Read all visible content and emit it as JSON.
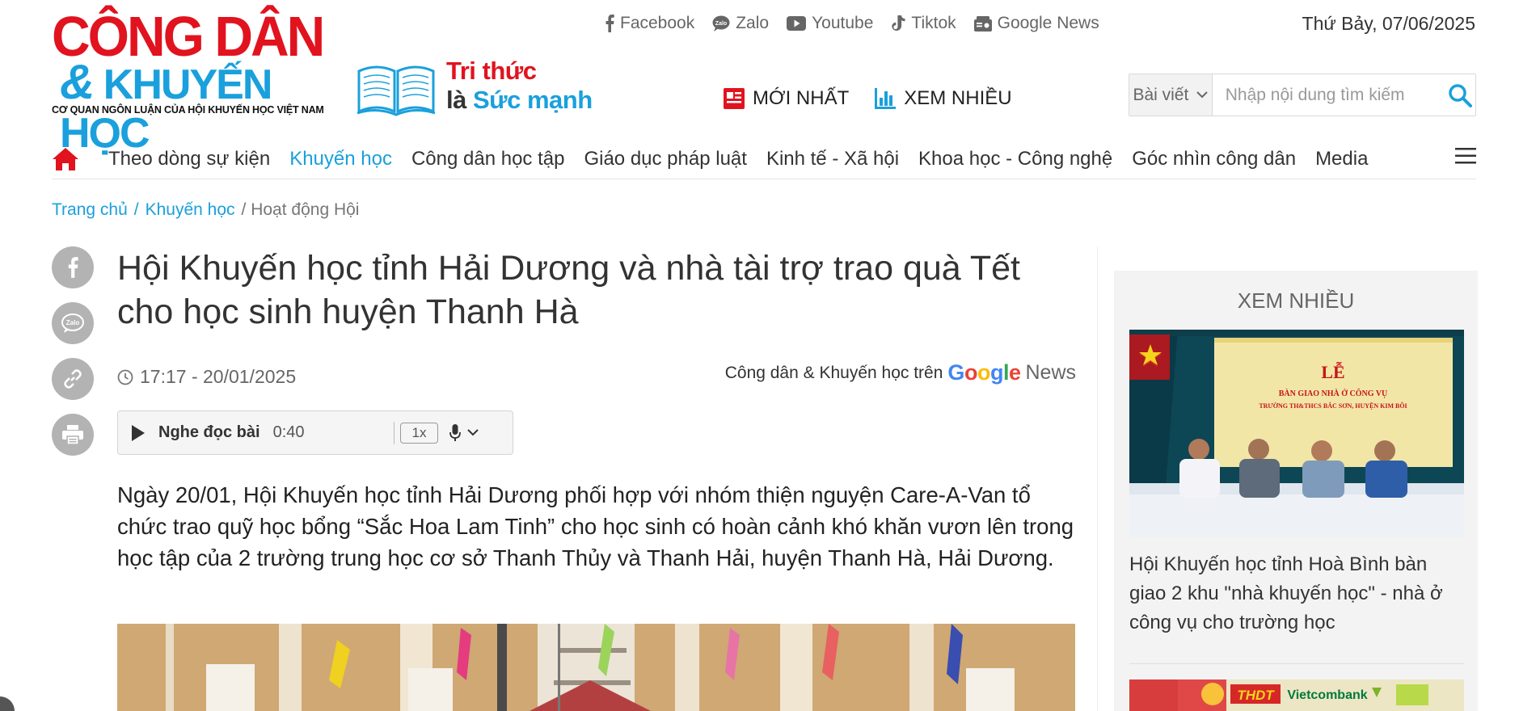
{
  "brand": {
    "logo_line1": "CÔNG DÂN",
    "logo_amp": "&",
    "logo_line2": "KHUYẾN HỌC",
    "logo_subtitle": "CƠ QUAN NGÔN LUẬN CỦA HỘI KHUYẾN HỌC VIỆT NAM",
    "slogan_line1": "Tri thức",
    "slogan_line2_prefix": "là ",
    "slogan_line2_highlight": "Sức mạnh"
  },
  "social": [
    {
      "label": "Facebook",
      "icon": "facebook-icon"
    },
    {
      "label": "Zalo",
      "icon": "zalo-icon"
    },
    {
      "label": "Youtube",
      "icon": "youtube-icon"
    },
    {
      "label": "Tiktok",
      "icon": "tiktok-icon"
    },
    {
      "label": "Google News",
      "icon": "google-news-icon"
    }
  ],
  "date": "Thứ Bảy, 07/06/2025",
  "quick_links": {
    "newest": "MỚI NHẤT",
    "most_viewed": "XEM NHIỀU"
  },
  "search": {
    "category": "Bài viết",
    "placeholder": "Nhập nội dung tìm kiếm"
  },
  "nav": {
    "items": [
      "Theo dòng sự kiện",
      "Khuyến học",
      "Công dân học tập",
      "Giáo dục pháp luật",
      "Kinh tế - Xã hội",
      "Khoa học - Công nghệ",
      "Góc nhìn công dân",
      "Media"
    ],
    "active_index": 1
  },
  "breadcrumb": {
    "home": "Trang chủ",
    "sep1": "/",
    "section": "Khuyến học",
    "current": "/ Hoạt động Hội"
  },
  "article": {
    "title": "Hội Khuyến học tỉnh Hải Dương và nhà tài trợ trao quà Tết cho học sinh huyện Thanh Hà",
    "time": "17:17 - 20/01/2025",
    "gnews_prefix": "Công dân & Khuyến học trên",
    "gnews_word": "News",
    "player_label": "Nghe đọc bài",
    "player_duration": "0:40",
    "player_speed": "1x",
    "lead": "Ngày 20/01, Hội Khuyến học tỉnh Hải Dương phối hợp với nhóm thiện nguyện Care-A-Van tổ chức trao quỹ học bổng “Sắc Hoa Lam Tinh” cho học sinh có hoàn cảnh khó khăn vươn lên trong học tập của 2 trường trung học cơ sở Thanh Thủy và Thanh Hải, huyện Thanh Hà, Hải Dương."
  },
  "sidebar": {
    "title": "XEM NHIỀU",
    "story1_banner_big": "LỄ",
    "story1_banner_small": "BÀN GIAO NHÀ Ở CÔNG VỤ",
    "story1_banner_small2": "TRƯỜNG TH&THCS BẮC SƠN, HUYỆN KIM BÔI",
    "story1_title": "Hội Khuyến học tỉnh Hoà Bình bàn giao 2 khu \"nhà khuyến học\" - nhà ở công vụ cho trường học",
    "story2_logo1": "THDT",
    "story2_logo2": "Vietcombank"
  },
  "colors": {
    "brand_red": "#e1131f",
    "brand_blue": "#1aa0dc",
    "icon_gray": "#b3b3b3"
  }
}
